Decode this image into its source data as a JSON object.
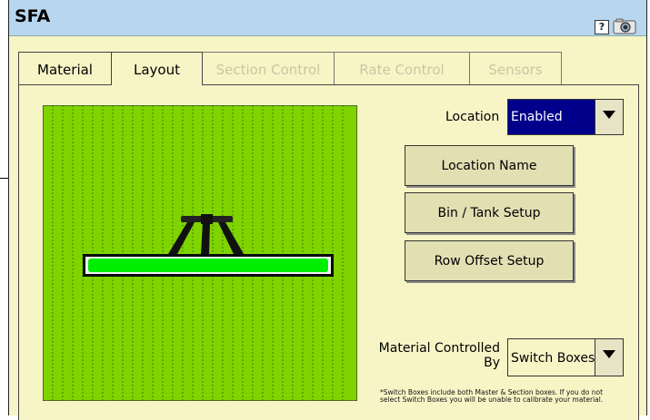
{
  "window": {
    "title": "SFA"
  },
  "tabs": [
    {
      "label": "Material",
      "state": "normal"
    },
    {
      "label": "Layout",
      "state": "active"
    },
    {
      "label": "Section Control",
      "state": "disabled"
    },
    {
      "label": "Rate Control",
      "state": "disabled"
    },
    {
      "label": "Sensors",
      "state": "disabled"
    }
  ],
  "location": {
    "label": "Location",
    "value": "Enabled"
  },
  "buttons": {
    "location_name": "Location Name",
    "bin_tank_setup": "Bin / Tank Setup",
    "row_offset_setup": "Row Offset Setup"
  },
  "material_controlled": {
    "label_line1": "Material Controlled",
    "label_line2": "By",
    "value": "Switch Boxes"
  },
  "note": "*Switch Boxes include both Master & Section boxes.  If you do not select Switch Boxes you will be unable to calibrate your material.",
  "icons": {
    "help": "help-icon",
    "camera": "camera-icon"
  },
  "colors": {
    "titlebar": "#b8d7ef",
    "panel": "#f7f5c6",
    "field": "#7fd400",
    "boom": "#00ee00",
    "select_enabled": "#00008b"
  }
}
